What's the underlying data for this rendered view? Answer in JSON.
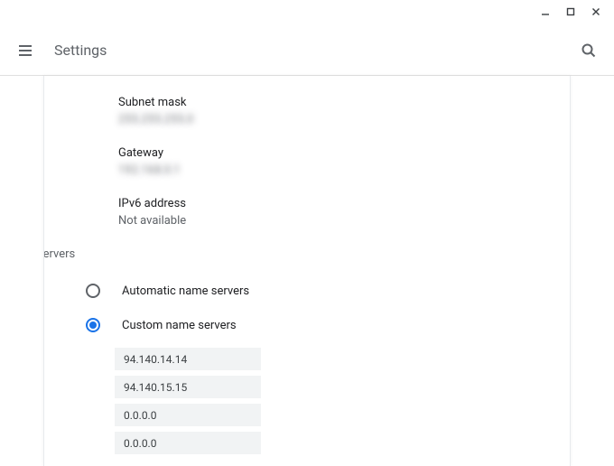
{
  "window": {
    "minimize_icon": "minimize",
    "maximize_icon": "maximize",
    "close_icon": "close"
  },
  "header": {
    "menu_icon": "menu",
    "title": "Settings",
    "search_icon": "search"
  },
  "network": {
    "subnet_mask_label": "Subnet mask",
    "subnet_mask_value": "255.255.255.0",
    "gateway_label": "Gateway",
    "gateway_value": "192.168.0.1",
    "ipv6_label": "IPv6 address",
    "ipv6_value": "Not available"
  },
  "name_servers": {
    "section_title": "Name servers",
    "automatic_label": "Automatic name servers",
    "custom_label": "Custom name servers",
    "selected": "custom",
    "servers": [
      "94.140.14.14",
      "94.140.15.15",
      "0.0.0.0",
      "0.0.0.0"
    ]
  }
}
